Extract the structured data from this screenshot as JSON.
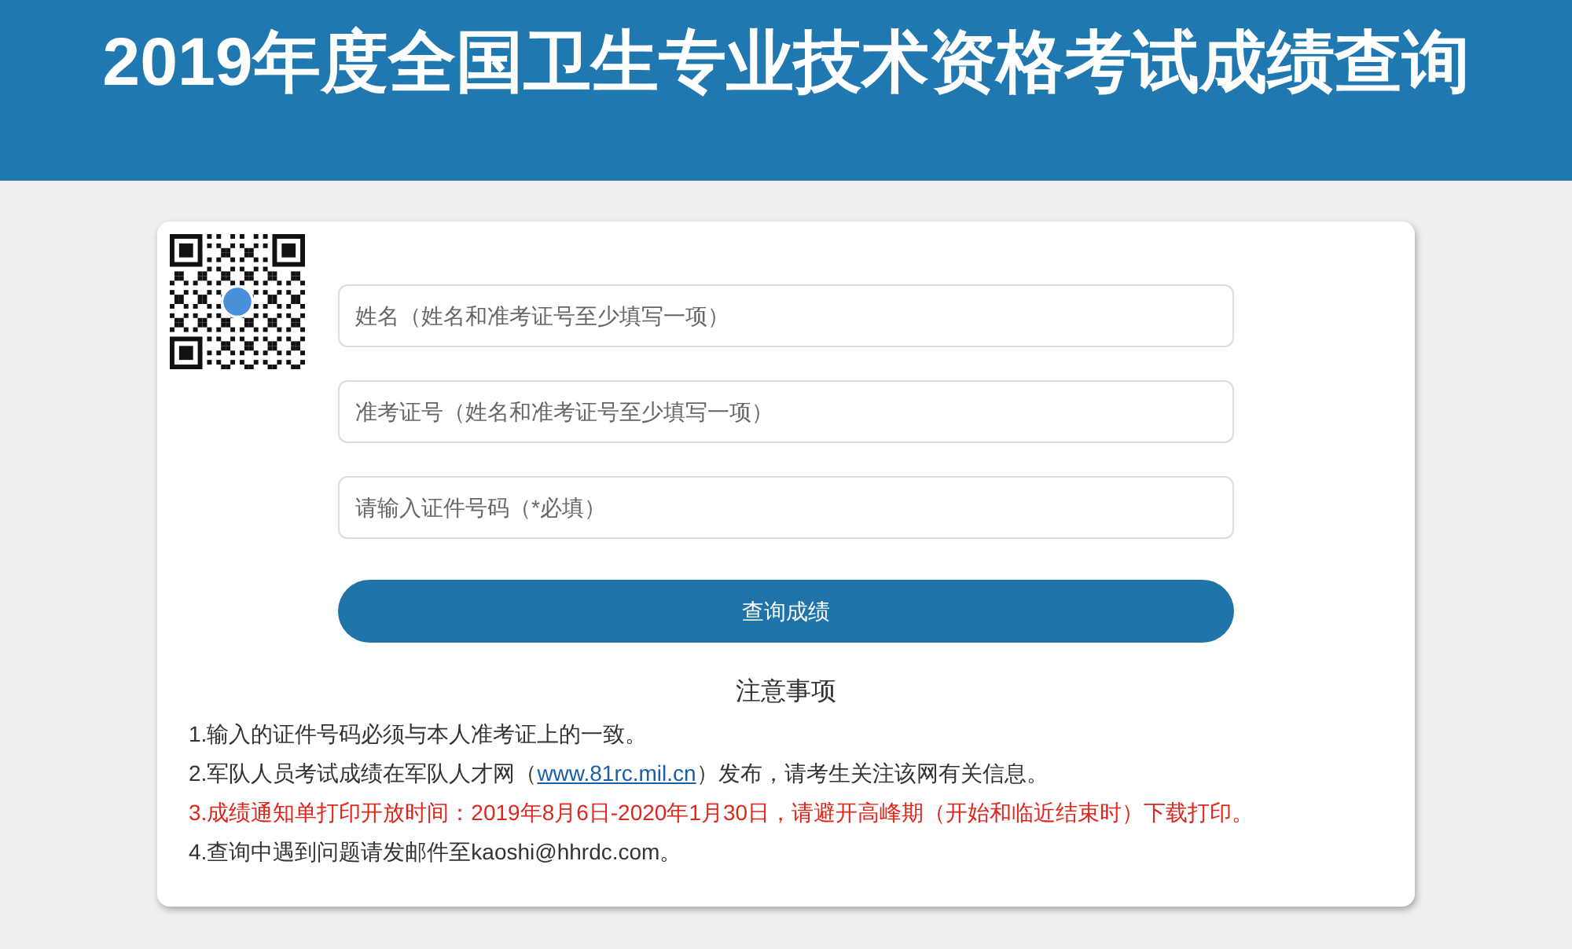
{
  "header": {
    "title": "2019年度全国卫生专业技术资格考试成绩查询"
  },
  "form": {
    "fields": [
      {
        "placeholder": "姓名（姓名和准考证号至少填写一项）"
      },
      {
        "placeholder": "准考证号（姓名和准考证号至少填写一项）"
      },
      {
        "placeholder": "请输入证件号码（*必填）"
      }
    ],
    "submit": "查询成绩"
  },
  "notes": {
    "title": "注意事项",
    "items": [
      {
        "kind": "normal",
        "text": "1.输入的证件号码必须与本人准考证上的一致。"
      },
      {
        "kind": "normal",
        "text": "2.军队人员考试成绩在军队人才网（",
        "link": "www.81rc.mil.cn",
        "after": "）发布，请考生关注该网有关信息。"
      },
      {
        "kind": "warning",
        "text": "3.成绩通知单打印开放时间：2019年8月6日-2020年1月30日，请避开高峰期（开始和临近结束时）下载打印。"
      },
      {
        "kind": "normal",
        "text": "4.查询中遇到问题请发邮件至kaoshi@hhrdc.com。"
      }
    ]
  }
}
